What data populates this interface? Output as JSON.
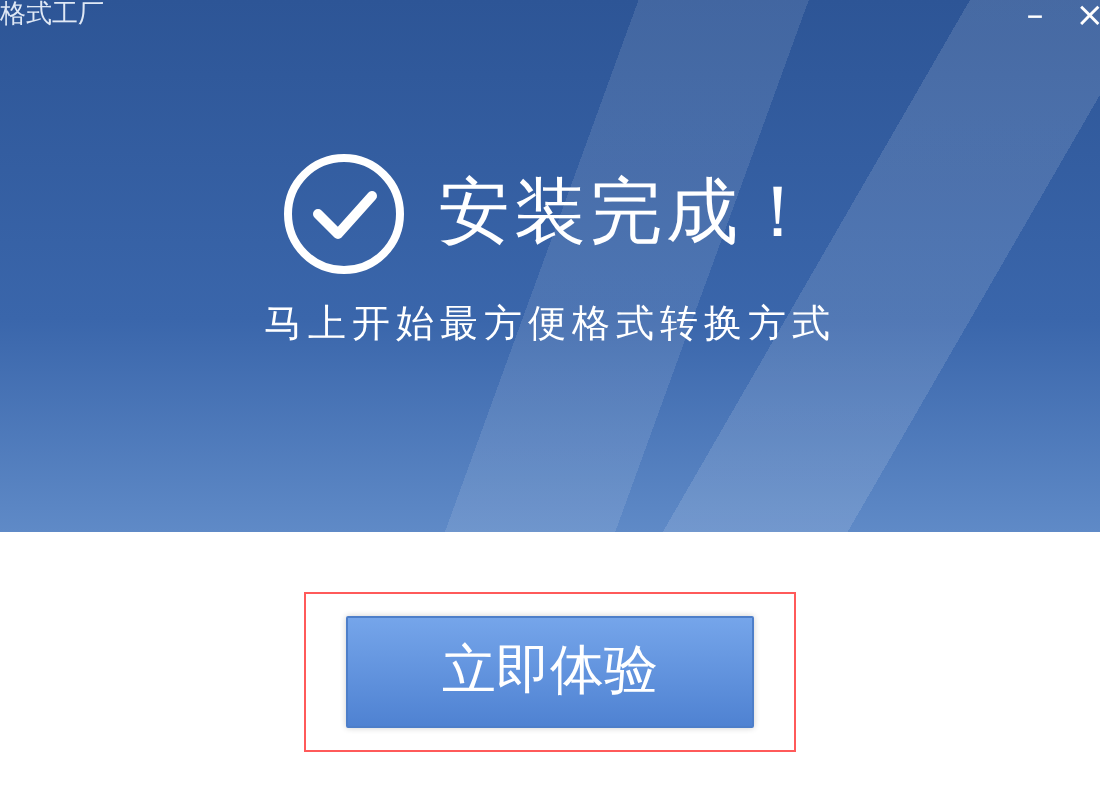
{
  "window": {
    "title": "格式工厂",
    "controls": [
      "–",
      "×"
    ]
  },
  "banner": {
    "heading": "安装完成！",
    "subheading": "马上开始最方便格式转换方式"
  },
  "action": {
    "label": "立即体验",
    "highlighted": true
  }
}
